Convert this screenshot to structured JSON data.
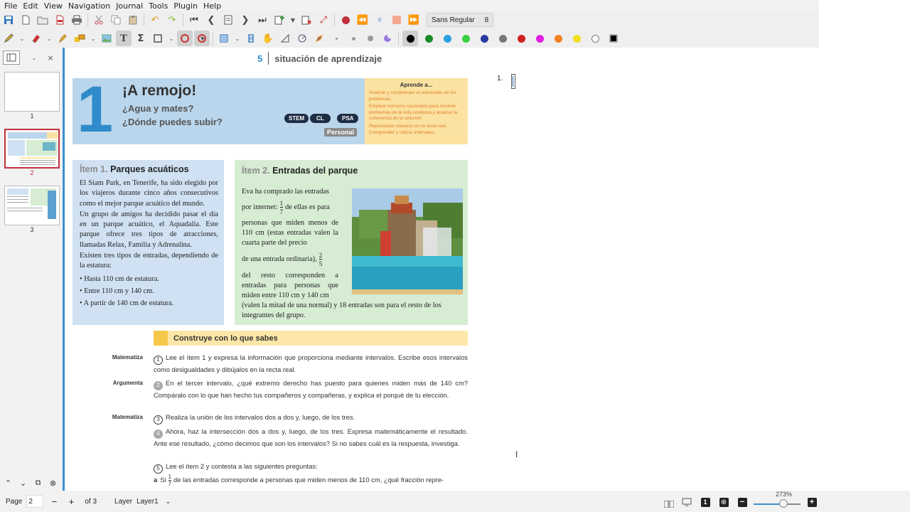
{
  "menu": [
    "File",
    "Edit",
    "View",
    "Navigation",
    "Journal",
    "Tools",
    "Plugin",
    "Help"
  ],
  "toolbar": {
    "font_name": "Sans Regular",
    "font_size": "8"
  },
  "sidebar": {
    "pages": [
      {
        "number": "1"
      },
      {
        "number": "2"
      },
      {
        "number": "3"
      }
    ]
  },
  "page": {
    "header_number": "5",
    "header_title": "situación de aprendizaje",
    "big_number": "1",
    "title": "¡A remojo!",
    "subtitle_1": "¿Agua y mates?",
    "subtitle_2": "¿Dónde puedes subir?",
    "badges": [
      "STEM",
      "CL",
      "PSA"
    ],
    "personal_badge": "Personal",
    "aprende": {
      "title": "Aprende a...",
      "items": [
        "Analizar y comprender el enunciado de los problemas.",
        "Emplear números racionales para resolver problemas de la vida cotidiana y analizar la coherencia de la solución.",
        "Representar números en la recta real. Comprender y utilizar intervalos."
      ]
    },
    "item1": {
      "prefix": "Ítem 1.",
      "title": "Parques acuáticos",
      "p1": "El Siam Park, en Tenerife, ha sido elegido por los viajeros durante cinco años consecutivos como el mejor parque acuático del mundo.",
      "p2": "Un grupo de amigos ha decidido pasar el día en un parque acuático, el Aquadalia. Este parque ofrece tres tipos de atracciones, llamadas Relax, Familia y Adrenalina.",
      "p3": "Existen tres tipos de entradas, dependiendo de la estatura:",
      "bullets": [
        "Hasta 110 cm de estatura.",
        "Entre 110 cm y 140 cm.",
        "A partir de 140 cm de estatura."
      ]
    },
    "item2": {
      "prefix": "Ítem 2.",
      "title": "Entradas del parque",
      "line1": "Eva ha comprado las entradas",
      "line2a": "por internet:",
      "frac1_num": "1",
      "frac1_den": "7",
      "line2b": "de ellas es para",
      "line3": "personas que miden menos de 110 cm (estas entradas valen la cuarta parte del precio",
      "line4": "de una entrada ordinaria),",
      "frac2_num": "2",
      "frac2_den": "5",
      "line5": "del resto corresponden a entradas para personas que miden entre 110 cm y 140 cm",
      "line6": "(valen la mitad de una normal) y 18 entradas son para el resto de los integrantes del grupo."
    },
    "construye": {
      "title": "Construye con lo que sabes",
      "questions": [
        {
          "label": "Matematiza",
          "num": "1",
          "text": "Lee el ítem 1 y expresa la información que proporciona mediante intervalos. Escribe esos intervalos como desigualdades y dibújalos en la recta real."
        },
        {
          "label": "Argumenta",
          "num": "2",
          "text": "En el tercer intervalo, ¿qué extremo derecho has puesto para quienes miden más de 140 cm? Compáralo con lo que han hecho tus compañeros y compañeras, y explica el porqué de tu elección."
        },
        {
          "label": "Matematiza",
          "num": "3",
          "text": "Realiza la unión de los intervalos dos a dos y, luego, de los tres."
        },
        {
          "label": "",
          "num": "4",
          "text": "Ahora, haz la intersección dos a dos y, luego, de los tres. Expresa matemáticamente el resultado. Ante ese resultado, ¿cómo decimos que son los intervalos? Si no sabes cuál es la respuesta, investiga."
        },
        {
          "label": "",
          "num": "5",
          "text": "Lee el ítem 2 y contesta a las siguientes preguntas:"
        }
      ],
      "sub_a_prefix": "a",
      "sub_a_si": "Si",
      "sub_a_frac_num": "1",
      "sub_a_frac_den": "7",
      "sub_a_text": "de las entradas corresponde a personas que miden menos de 110 cm, ¿qué fracción repre-"
    },
    "note_number": "1."
  },
  "status": {
    "page_label": "Page",
    "page_value": "2",
    "of_pages": "of 3",
    "layer_label": "Layer",
    "layer_value": "Layer1",
    "zoom": "273%"
  },
  "colors": {
    "accent_blue": "#3a8fd0",
    "header_blue": "#b9d6ec",
    "aprende_yellow": "#fbe2a0",
    "item1_bg": "#cfe1f2",
    "item2_bg": "#d6ecd3",
    "construye_bar": "#fde7a8",
    "selection_red": "#c0303a"
  }
}
